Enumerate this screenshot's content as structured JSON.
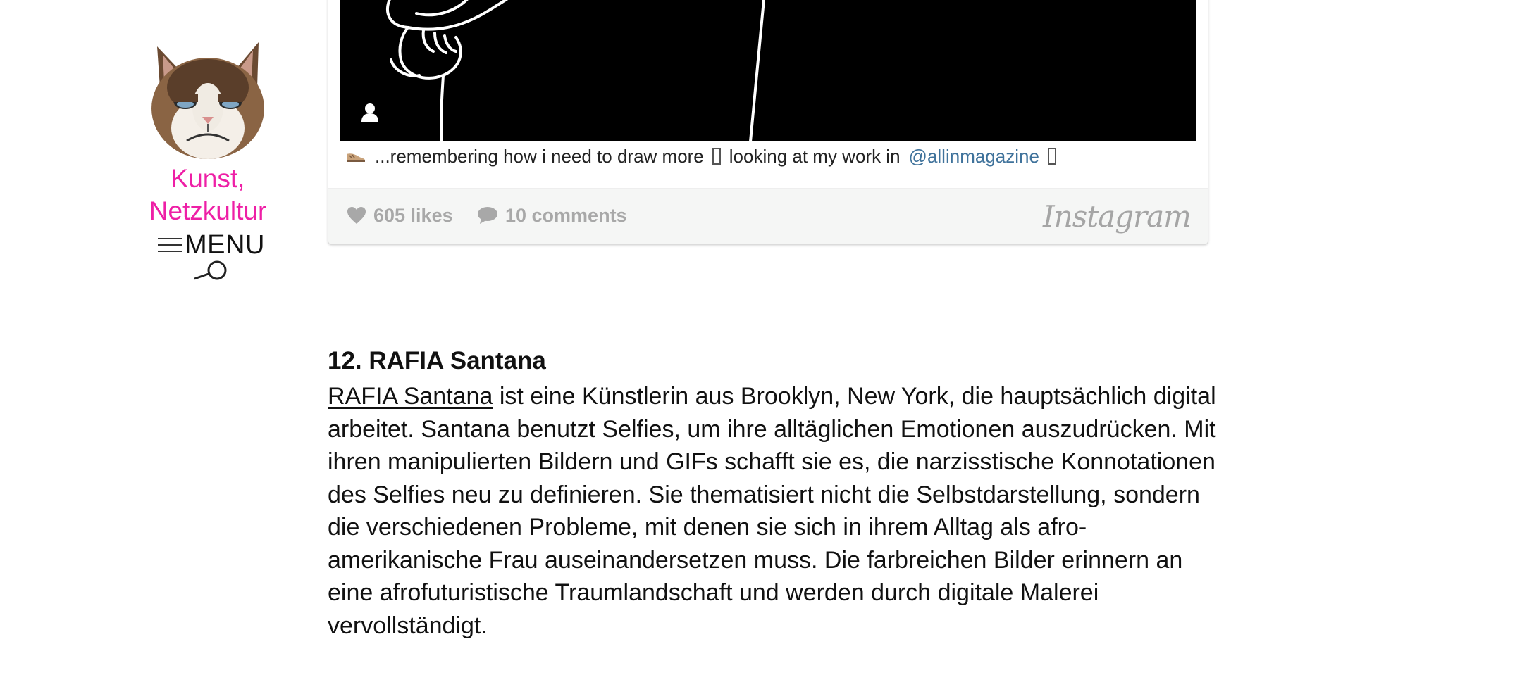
{
  "sidebar": {
    "site_name_line1": "Kunst,",
    "site_name_line2": "Netzkultur",
    "menu_label": "MENU",
    "logo_icon": "grumpy-cat-logo",
    "menu_icon": "hamburger-icon",
    "search_icon": "search-icon"
  },
  "instagram_embed": {
    "caption_emoji": "shoe-emoji",
    "caption_part1": "...remembering how i need to draw more",
    "caption_part2": "looking at my work in",
    "mention": "@allinmagazine",
    "likes": "605 likes",
    "comments": "10 comments",
    "brand": "Instagram",
    "colors": {
      "mention": "#3f729b",
      "footer_bg": "#f5f6f5",
      "stat_text": "#a8a8a8"
    }
  },
  "article": {
    "heading": "12. RAFIA Santana",
    "artist_link": "RAFIA Santana",
    "body": " ist eine Künstlerin aus Brooklyn, New York, die hauptsächlich digital arbeitet. Santana benutzt Selfies, um ihre alltäglichen Emotionen auszudrücken. Mit ihren manipulierten Bildern und GIFs schafft sie es, die narzisstische Konnotationen des Selfies neu zu definieren. Sie thematisiert nicht die Selbstdarstellung, sondern die verschiedenen Probleme, mit denen sie sich in ihrem Alltag als afro-amerikanische Frau auseinandersetzen muss. Die farbreichen Bilder erinnern an eine afrofuturistische Traumlandschaft und werden durch digitale Malerei vervollständigt."
  },
  "colors": {
    "accent": "#ee1fa6",
    "text": "#111111"
  }
}
